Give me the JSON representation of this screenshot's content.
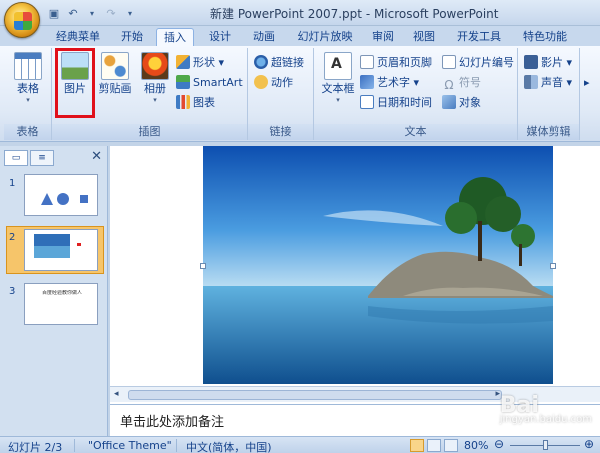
{
  "window": {
    "title": "新建 PowerPoint 2007.ppt - Microsoft PowerPoint"
  },
  "tabs": [
    "经典菜单",
    "开始",
    "插入",
    "设计",
    "动画",
    "幻灯片放映",
    "审阅",
    "视图",
    "开发工具",
    "特色功能"
  ],
  "active_tab": "插入",
  "ribbon": {
    "table_group": {
      "label": "表格",
      "table_button": "表格"
    },
    "illustrations_group": {
      "label": "插图",
      "picture_button": "图片",
      "clipart_button": "剪贴画",
      "album_button": "相册",
      "shapes_button": "形状",
      "smartart_button": "SmartArt",
      "chart_button": "图表"
    },
    "links_group": {
      "label": "链接",
      "hyperlink_button": "超链接",
      "action_button": "动作"
    },
    "text_group": {
      "label": "文本",
      "textbox_button": "文本框",
      "header_footer_button": "页眉和页脚",
      "wordart_button": "艺术字",
      "datetime_button": "日期和时间",
      "slide_number_button": "幻灯片编号",
      "symbol_button": "符号",
      "object_button": "对象"
    },
    "media_group": {
      "label": "媒体剪辑",
      "movie_button": "影片",
      "sound_button": "声音"
    }
  },
  "slides_pane": {
    "numbers": [
      "1",
      "2",
      "3"
    ],
    "slide3_text": "百度经验教你做人"
  },
  "notes": {
    "placeholder": "单击此处添加备注"
  },
  "status": {
    "slide_position": "幻灯片 2/3",
    "theme": "\"Office Theme\"",
    "language": "中文(简体，中国)",
    "zoom": "80%"
  },
  "watermark": {
    "brand": "Bai",
    "sub": "jingyan.baidu.com"
  }
}
